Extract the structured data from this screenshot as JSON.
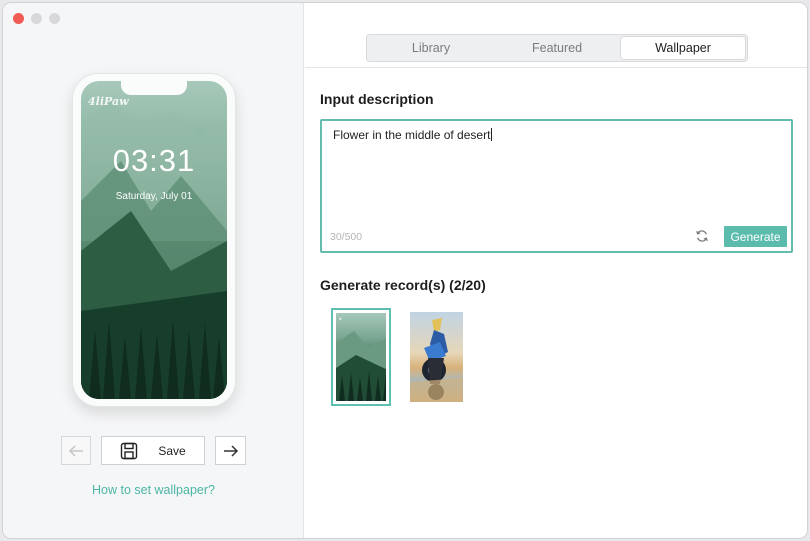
{
  "window": {
    "controls": [
      "close",
      "minimize",
      "zoom"
    ]
  },
  "preview": {
    "brand": "4liPaw",
    "time": "03:31",
    "date": "Saturday, July 01"
  },
  "actions": {
    "prev_icon": "arrow-left-icon",
    "save_icon": "save-disk-icon",
    "save_label": "Save",
    "next_icon": "arrow-right-icon",
    "help_link": "How to set wallpaper?"
  },
  "tabs": [
    {
      "label": "Library",
      "active": false
    },
    {
      "label": "Featured",
      "active": false
    },
    {
      "label": "Wallpaper",
      "active": true
    }
  ],
  "input": {
    "title": "Input description",
    "value": "Flower in the middle of desert",
    "count": "30/500",
    "refresh_icon": "refresh-icon",
    "generate_label": "Generate"
  },
  "records": {
    "title": "Generate record(s) (2/20)",
    "items": [
      {
        "name": "forest-mountain-wallpaper",
        "selected": true
      },
      {
        "name": "motorcycle-rider-wallpaper",
        "selected": false
      }
    ]
  },
  "colors": {
    "accent": "#5bbcad",
    "link": "#4bb6a5",
    "close": "#f05c55"
  }
}
